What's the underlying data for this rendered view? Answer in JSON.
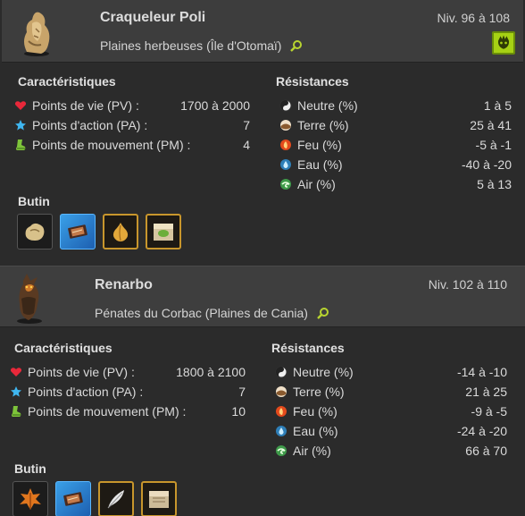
{
  "monsters": [
    {
      "name": "Craqueleur Poli",
      "level": "Niv. 96 à 108",
      "location": "Plaines herbeuses (Île d'Otomaï)",
      "characteristics_title": "Caractéristiques",
      "resistances_title": "Résistances",
      "loot_title": "Butin",
      "stats": [
        {
          "icon": "heart-icon",
          "label": "Points de vie (PV) :",
          "value": "1700 à 2000"
        },
        {
          "icon": "star-icon",
          "label": "Points d'action (PA) :",
          "value": "7"
        },
        {
          "icon": "boot-icon",
          "label": "Points de mouvement (PM) :",
          "value": "4"
        }
      ],
      "resistances": [
        {
          "icon": "neutral-icon",
          "label": "Neutre (%)",
          "value": "1 à 5"
        },
        {
          "icon": "earth-icon",
          "label": "Terre (%)",
          "value": "25 à 41"
        },
        {
          "icon": "fire-icon",
          "label": "Feu (%)",
          "value": "-5 à -1"
        },
        {
          "icon": "water-icon",
          "label": "Eau (%)",
          "value": "-40 à -20"
        },
        {
          "icon": "air-icon",
          "label": "Air (%)",
          "value": "5 à 13"
        }
      ],
      "loot": [
        "rock-loot-icon",
        "card-loot-icon",
        "onion-loot-icon",
        "chest-loot-icon"
      ]
    },
    {
      "name": "Renarbo",
      "level": "Niv. 102 à 110",
      "location": "Pénates du Corbac (Plaines de Cania)",
      "characteristics_title": "Caractéristiques",
      "resistances_title": "Résistances",
      "loot_title": "Butin",
      "stats": [
        {
          "icon": "heart-icon",
          "label": "Points de vie (PV) :",
          "value": "1800 à 2100"
        },
        {
          "icon": "star-icon",
          "label": "Points d'action (PA) :",
          "value": "7"
        },
        {
          "icon": "boot-icon",
          "label": "Points de mouvement (PM) :",
          "value": "10"
        }
      ],
      "resistances": [
        {
          "icon": "neutral-icon",
          "label": "Neutre (%)",
          "value": "-14 à -10"
        },
        {
          "icon": "earth-icon",
          "label": "Terre (%)",
          "value": "21 à 25"
        },
        {
          "icon": "fire-icon",
          "label": "Feu (%)",
          "value": "-9 à -5"
        },
        {
          "icon": "water-icon",
          "label": "Eau (%)",
          "value": "-24 à -20"
        },
        {
          "icon": "air-icon",
          "label": "Air (%)",
          "value": "66 à 70"
        }
      ],
      "loot": [
        "leaf-loot-icon",
        "card-loot-icon",
        "feather-loot-icon",
        "crate-loot-icon"
      ]
    }
  ]
}
